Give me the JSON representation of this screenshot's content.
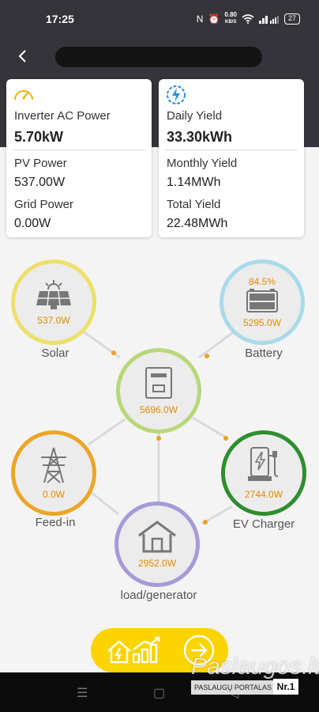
{
  "status_bar": {
    "time": "17:25",
    "net_speed": "0.80",
    "net_unit": "KB/S",
    "battery": "27",
    "icons": [
      "nfc-icon",
      "alarm-icon",
      "wifi-icon",
      "signal-icon"
    ]
  },
  "header": {
    "back_icon": "chevron-left-icon",
    "title": ""
  },
  "power_card": {
    "icon": "speedometer-icon",
    "head_label": "Inverter AC Power",
    "head_value": "5.70kW",
    "rows": [
      {
        "label": "PV Power",
        "value": "537.00W"
      },
      {
        "label": "Grid Power",
        "value": "0.00W"
      }
    ]
  },
  "yield_card": {
    "icon": "lightning-icon",
    "head_label": "Daily Yield",
    "head_value": "33.30kWh",
    "rows": [
      {
        "label": "Monthly Yield",
        "value": "1.14MWh"
      },
      {
        "label": "Total Yield",
        "value": "22.48MWh"
      }
    ]
  },
  "flow": {
    "solar": {
      "label": "Solar",
      "value": "537.0W",
      "icon": "solar-panel-icon",
      "color": "#ede06a"
    },
    "battery": {
      "label": "Battery",
      "value": "5295.0W",
      "percent": "84.5%",
      "icon": "battery-icon",
      "color": "#a9dbe9"
    },
    "inverter": {
      "value": "5696.0W",
      "icon": "inverter-icon",
      "color": "#b8d77a"
    },
    "feedin": {
      "label": "Feed-in",
      "value": "0.0W",
      "icon": "power-tower-icon",
      "color": "#eba628"
    },
    "ev": {
      "label": "EV Charger",
      "value": "2744.0W",
      "icon": "ev-charger-icon",
      "color": "#2f8e2f"
    },
    "load": {
      "label": "load/generator",
      "value": "2952.0W",
      "icon": "house-icon",
      "color": "#a999d8"
    }
  },
  "action_button": {
    "icons": [
      "home-energy-trend-icon",
      "arrow-right-circle-icon"
    ],
    "color": "#fcd400"
  },
  "watermark": {
    "text": "Paslaugos.lt",
    "sub": "PASLAUGŲ PORTALAS",
    "badge": "Nr.1"
  }
}
